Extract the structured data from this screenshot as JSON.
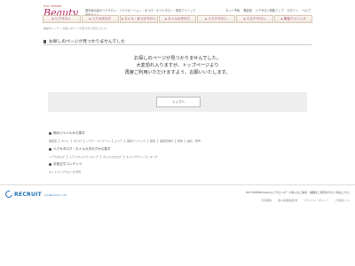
{
  "header": {
    "logo_top": "HOT PEPPER",
    "logo_main": "Beauty",
    "logo_sub": "presented by Recruit",
    "tagline": "国内最大級のヘアサロン・リラクゼーション・まつげ・ネイルサロン・美容クリニック",
    "tagline2": "予約サイト",
    "toplinks": [
      "ネット予約",
      "美容室",
      "ヘアサロン特集トップ",
      "ログイン",
      "ヘルプ"
    ]
  },
  "nav": {
    "items": [
      "ヘアサロン",
      "ヘアカタログ",
      "ネイル・まつげサロン",
      "ネイルカタログ",
      "リラクサロン",
      "エステサロン",
      "美容クリニック"
    ]
  },
  "breadcrumb": "美容室トップ ＞ お探しのページが見つかりませんでした",
  "page_title": "お探しのページが見つかりませんでした",
  "message": {
    "line1": "お探しのページが見つかりませんでした。",
    "line2": "大変恐れ入りますが、トップページより",
    "line3": "再度ご利用いただけますよう、お願いいたします。"
  },
  "top_button": "トップへ",
  "genres": {
    "title": "他のジャンルから探す",
    "links": [
      "美容室",
      "ネイル",
      "まつげ",
      "リラク・マッサージ",
      "エステ",
      "美容クリニック",
      "脱毛",
      "美容皮膚科",
      "整体",
      "鍼灸・整骨"
    ]
  },
  "catalog": {
    "title": "ヘアカタログ・ネイルカタログから探す",
    "links": [
      "ヘアカタログ",
      "ヘアスタイルランキング",
      "ネイルカタログ",
      "ネイルデザインランキング"
    ]
  },
  "contents": {
    "title": "お役立ちコンテンツ",
    "links": [
      "ネットでヘアサロンを予約"
    ]
  },
  "footer": {
    "brand": "RECRUIT",
    "brand_sub": "(C) Recruit Co., Ltd.",
    "right_line": "HOT PEPPER Beautyとサロンボード導入のご案内　掲載をご希望のサロン様はこちら",
    "right_links": [
      "利用規約",
      "個人情報保護方針",
      "プライバシーポリシー",
      "ご利用ガイド"
    ]
  }
}
